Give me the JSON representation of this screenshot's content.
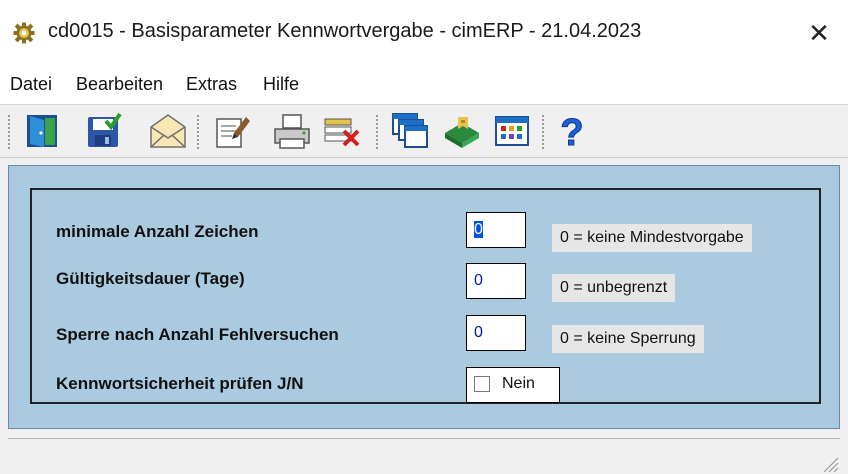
{
  "window": {
    "title": "cd0015 - Basisparameter Kennwortvergabe - cimERP - 21.04.2023",
    "close_glyph": "✕",
    "title_icon": "gear-icon"
  },
  "menu": {
    "items": [
      "Datei",
      "Bearbeiten",
      "Extras",
      "Hilfe"
    ]
  },
  "toolbar": {
    "icons": [
      "exit-door-icon",
      "save-icon",
      "mail-icon",
      "edit-document-icon",
      "print-icon",
      "delete-record-icon",
      "windows-icon",
      "book-icon",
      "table-view-icon",
      "help-icon"
    ]
  },
  "form": {
    "rows": [
      {
        "label": "minimale Anzahl Zeichen",
        "value": "0",
        "hint": "0 = keine Mindestvorgabe"
      },
      {
        "label": "Gültigkeitsdauer (Tage)",
        "value": "0",
        "hint": "0 = unbegrenzt"
      },
      {
        "label": "Sperre nach Anzahl Fehlversuchen",
        "value": "0",
        "hint": "0 = keine Sperrung"
      }
    ],
    "check": {
      "label": "Kennwortsicherheit prüfen J/N",
      "value": "Nein",
      "checked": false
    }
  },
  "colors": {
    "content_bg": "#aacbdf",
    "field_text": "#0018a8"
  }
}
